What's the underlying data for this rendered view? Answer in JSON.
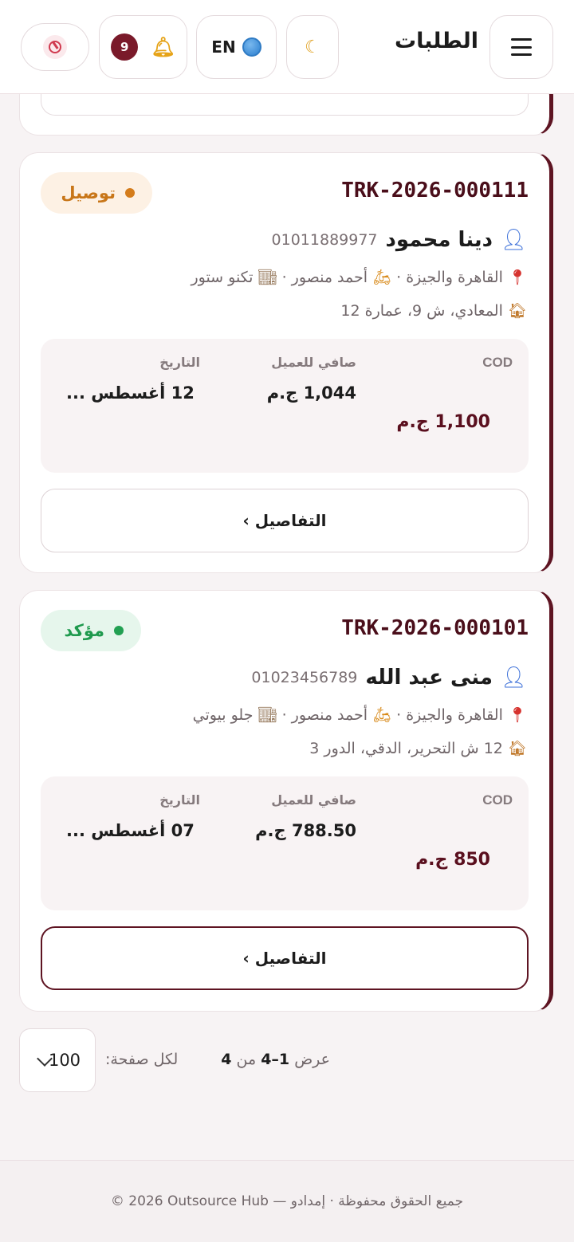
{
  "header": {
    "title": "الطلبات",
    "lang_label": "EN",
    "notifications_count": "9",
    "icons": {
      "menu": "menu-icon",
      "theme": "moon-icon",
      "lang": "globe-icon",
      "bell": "bell-icon",
      "logout": "logout-icon"
    }
  },
  "orders": [
    {
      "tracking": "TRK-2026-000111",
      "status": "توصيل",
      "status_color": "#d47c1b",
      "customer_name": "دينا محمود",
      "phone": "01011889977",
      "region": "القاهرة والجيزة",
      "courier": "أحمد منصور",
      "store": "تكنو ستور",
      "address": "المعادي، ش 9، عمارة 12",
      "labels": {
        "cod": "COD",
        "net": "صافي للعميل",
        "date": "التاريخ"
      },
      "cod": "1,100 ج.م",
      "net": "1,044 ج.م",
      "date": "12 أغسطس ...",
      "details": "التفاصيل ›"
    },
    {
      "tracking": "TRK-2026-000101",
      "status": "مؤكد",
      "status_color": "#22a052",
      "customer_name": "منى عبد الله",
      "phone": "01023456789",
      "region": "القاهرة والجيزة",
      "courier": "أحمد منصور",
      "store": "جلو بيوتي",
      "address": "12 ش التحرير، الدقي، الدور 3",
      "labels": {
        "cod": "COD",
        "net": "صافي للعميل",
        "date": "التاريخ"
      },
      "cod": "850 ج.م",
      "net": "788.50 ج.م",
      "date": "07 أغسطس ...",
      "details": "التفاصيل ›"
    }
  ],
  "pagination": {
    "show": "عرض",
    "range": "1–4",
    "of": "من",
    "total": "4",
    "per_page_label": "لكل صفحة:",
    "per_page_value": "100"
  },
  "footer": {
    "text": "© 2026 Outsource Hub — جميع الحقوق محفوظة · إمدادو"
  }
}
